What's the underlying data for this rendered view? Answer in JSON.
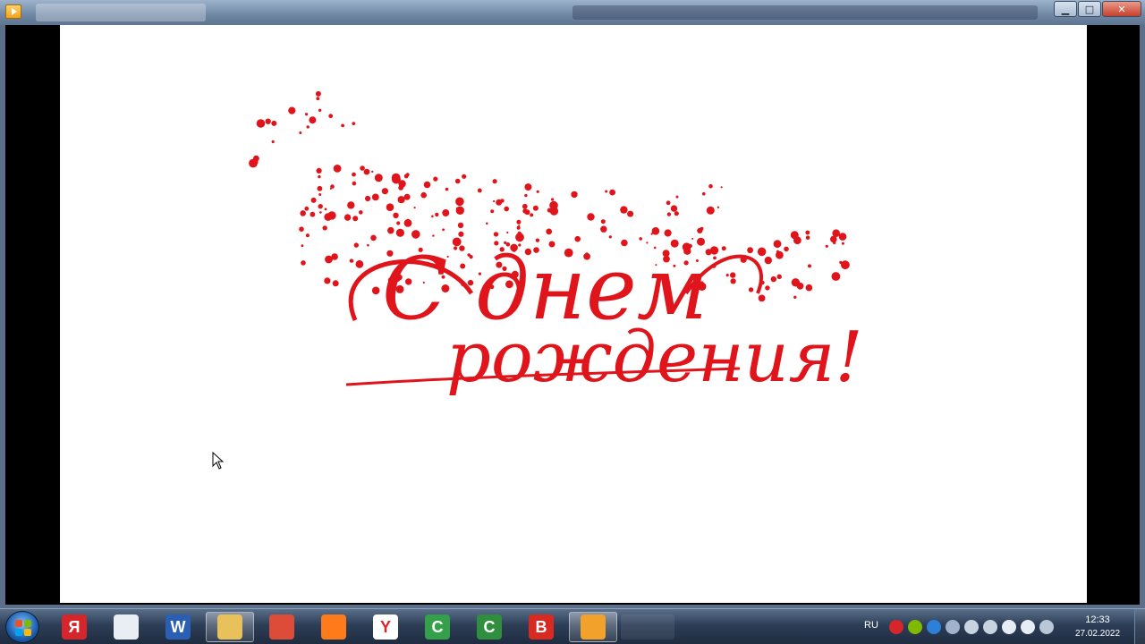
{
  "window": {
    "title": "",
    "buttons": {
      "minimize": "▁",
      "maximize": "□",
      "close": "✕"
    }
  },
  "video": {
    "greeting_line1": "С днем",
    "greeting_line2": "рождения!",
    "text_color": "#e0141b"
  },
  "taskbar": {
    "items": [
      {
        "name": "yandex-browser-taskbar",
        "glyph": "Я",
        "color": "#d7262b"
      },
      {
        "name": "archive-app-taskbar",
        "glyph": "",
        "color": "#e9eef5"
      },
      {
        "name": "word-taskbar",
        "glyph": "W",
        "color": "#2b5fb4"
      },
      {
        "name": "file-explorer-taskbar",
        "glyph": "",
        "color": "#e9c15b"
      },
      {
        "name": "chrome-taskbar",
        "glyph": "",
        "color": "#dd4b39"
      },
      {
        "name": "firefox-taskbar",
        "glyph": "",
        "color": "#ff7a1a"
      },
      {
        "name": "yandex-taskbar",
        "glyph": "Y",
        "color": "#ffffff"
      },
      {
        "name": "camtasia-taskbar",
        "glyph": "C",
        "color": "#35a04a"
      },
      {
        "name": "camtasia-recorder-taskbar",
        "glyph": "C",
        "color": "#2f8f3f"
      },
      {
        "name": "bandicam-taskbar",
        "glyph": "B",
        "color": "#d82a20"
      },
      {
        "name": "media-player-taskbar",
        "glyph": "",
        "color": "#f2a22a"
      }
    ]
  },
  "tray": {
    "language": "RU",
    "time": "12:33",
    "date": "27.02.2022"
  }
}
